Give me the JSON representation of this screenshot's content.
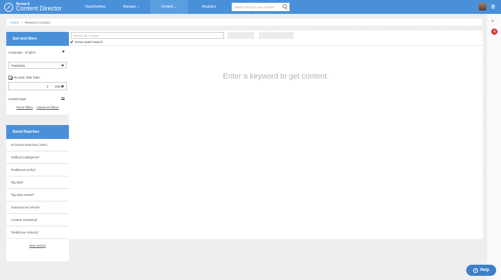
{
  "app": {
    "brand_top": "Scoop.it",
    "brand_bottom": "Content Director"
  },
  "nav": {
    "opportunities": "Opportunities",
    "manage": "Manage ⌄",
    "content": "Content ⌄",
    "analytics": "Analytics",
    "search_placeholder": "Search through your content"
  },
  "side": {
    "collapse": "«",
    "notifications": "4"
  },
  "breadcrumb": {
    "home": "Home",
    "separator": ">",
    "current": "Research Content"
  },
  "sort_panel": {
    "title": "Sort and filters",
    "language_label": "Language:",
    "language_value": "English",
    "sort_value": "Popularity",
    "age_filter_label": "No post older than:",
    "age_value": "3",
    "age_unit": "Month",
    "content_type_label": "Content type",
    "reset_filters": "Reset filters",
    "advanced_filters": "Advanced filters"
  },
  "saved_panel": {
    "title": "Saved Searches",
    "items": [
      "All Saved Searches (100+)",
      "\"artificial intelligence\"",
      "\"healthcare policy\"",
      "\"big data\"",
      "\"big data market\"",
      "\"autonomous vehicle\"",
      "\"content marketing\"",
      "\"healthcare industry\""
    ],
    "new_search": "New search"
  },
  "main": {
    "search_placeholder": "Search for content",
    "exact_match": "Exact match search",
    "empty_message": "Enter a keyword to get content."
  },
  "help": {
    "label": "Help"
  }
}
